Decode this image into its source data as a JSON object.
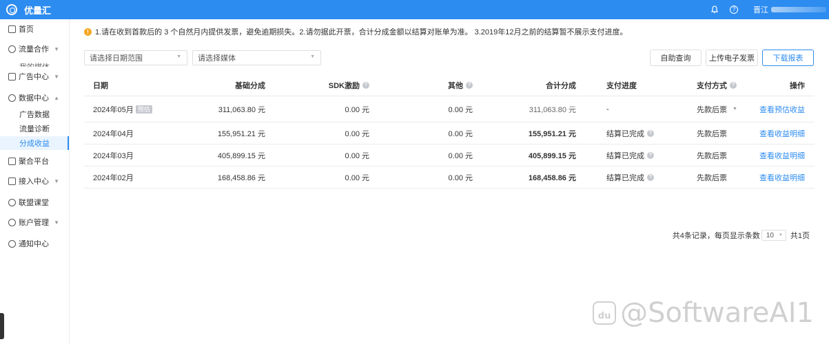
{
  "header": {
    "brand": "优量汇",
    "user_name": "晋江",
    "icons": [
      "bell-icon",
      "help-icon"
    ]
  },
  "sidebar": {
    "items": [
      {
        "label": "首页",
        "icon": "home-icon"
      },
      {
        "label": "流量合作",
        "icon": "traffic-icon"
      },
      {
        "label": "广告中心",
        "icon": "ad-icon"
      },
      {
        "label": "数据中心",
        "icon": "data-icon"
      },
      {
        "label": "聚合平台",
        "icon": "aggregate-icon"
      },
      {
        "label": "接入中心",
        "icon": "access-icon"
      },
      {
        "label": "联盟课堂",
        "icon": "classroom-icon"
      },
      {
        "label": "账户管理",
        "icon": "account-icon"
      },
      {
        "label": "通知中心",
        "icon": "notify-icon"
      }
    ],
    "sub_items": {
      "traffic": "我的媒体",
      "data_1": "广告数据",
      "data_2": "流量诊断",
      "data_3": "分成收益"
    }
  },
  "notice": "1.请在收到首款后的 3 个自然月内提供发票，避免逾期损失。2.请勿据此开票，合计分成金额以结算对账单为准。 3.2019年12月之前的结算暂不展示支付进度。",
  "filters": {
    "date_placeholder": "请选择日期范围",
    "media_placeholder": "请选择媒体"
  },
  "buttons": {
    "self_query": "自助查询",
    "upload_invoice": "上传电子发票",
    "download_report": "下载报表"
  },
  "table": {
    "headers": {
      "date": "日期",
      "base_share": "基础分成",
      "sdk_incentive": "SDK激励",
      "other": "其他",
      "total_share": "合计分成",
      "pay_progress": "支付进度",
      "pay_method": "支付方式",
      "action": "操作"
    },
    "rows": [
      {
        "date": "2024年05月",
        "tag": "预估",
        "base": "311,063.80 元",
        "sdk": "0.00 元",
        "other": "0.00 元",
        "total": "311,063.80 元",
        "progress": "-",
        "method": "先款后票",
        "action": "查看预估收益"
      },
      {
        "date": "2024年04月",
        "base": "155,951.21 元",
        "sdk": "0.00 元",
        "other": "0.00 元",
        "total": "155,951.21 元",
        "progress": "结算已完成",
        "method": "先款后票",
        "action": "查看收益明细"
      },
      {
        "date": "2024年03月",
        "base": "405,899.15 元",
        "sdk": "0.00 元",
        "other": "0.00 元",
        "total": "405,899.15 元",
        "progress": "结算已完成",
        "method": "先款后票",
        "action": "查看收益明细"
      },
      {
        "date": "2024年02月",
        "base": "168,458.86 元",
        "sdk": "0.00 元",
        "other": "0.00 元",
        "total": "168,458.86 元",
        "progress": "结算已完成",
        "method": "先款后票",
        "action": "查看收益明细"
      }
    ]
  },
  "pagination": {
    "total_text": "共4条记录，每页显示条数",
    "page_size": "10",
    "pages_text": "共1页"
  },
  "watermark": {
    "logo_text": "du",
    "text": "@SoftwareAI1"
  },
  "colors": {
    "brand": "#2d8cf0",
    "warning": "#f5a623"
  }
}
